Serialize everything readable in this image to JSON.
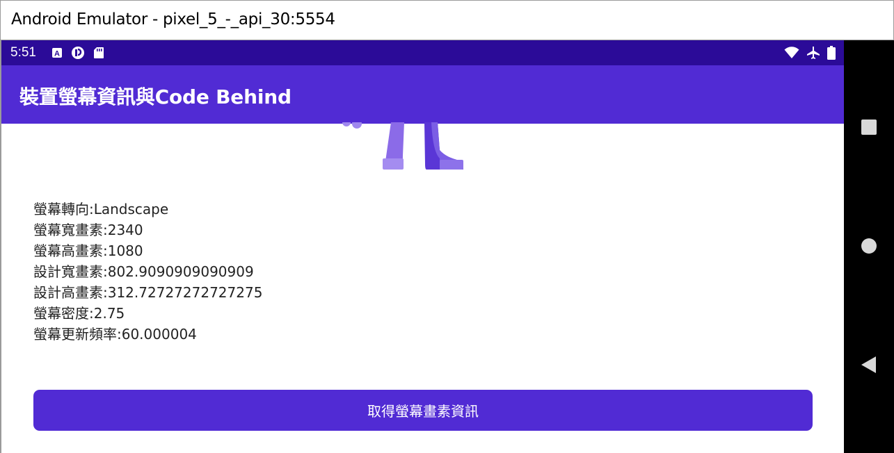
{
  "window": {
    "title": "Android Emulator - pixel_5_-_api_30:5554"
  },
  "status_bar": {
    "time": "5:51",
    "left_icons": [
      "accessibility-icon",
      "sync-icon",
      "sd-card-icon"
    ],
    "right_icons": [
      "wifi-icon",
      "airplane-mode-icon",
      "battery-icon"
    ]
  },
  "app_bar": {
    "title": "裝置螢幕資訊與Code Behind"
  },
  "info": {
    "orientation": "螢幕轉向:Landscape",
    "width_px": "螢幕寬畫素:2340",
    "height_px": "螢幕高畫素:1080",
    "design_width": "設計寬畫素:802.9090909090909",
    "design_height": "設計高畫素:312.72727272727275",
    "density": "螢幕密度:2.75",
    "refresh_rate": "螢幕更新頻率:60.000004"
  },
  "button": {
    "label": "取得螢幕畫素資訊"
  },
  "nav_bar": {
    "icons": [
      "recents-square-icon",
      "home-circle-icon",
      "back-triangle-icon"
    ]
  },
  "colors": {
    "status_bar": "#2b0b98",
    "app_bar": "#512bd4",
    "button": "#512bd4"
  }
}
